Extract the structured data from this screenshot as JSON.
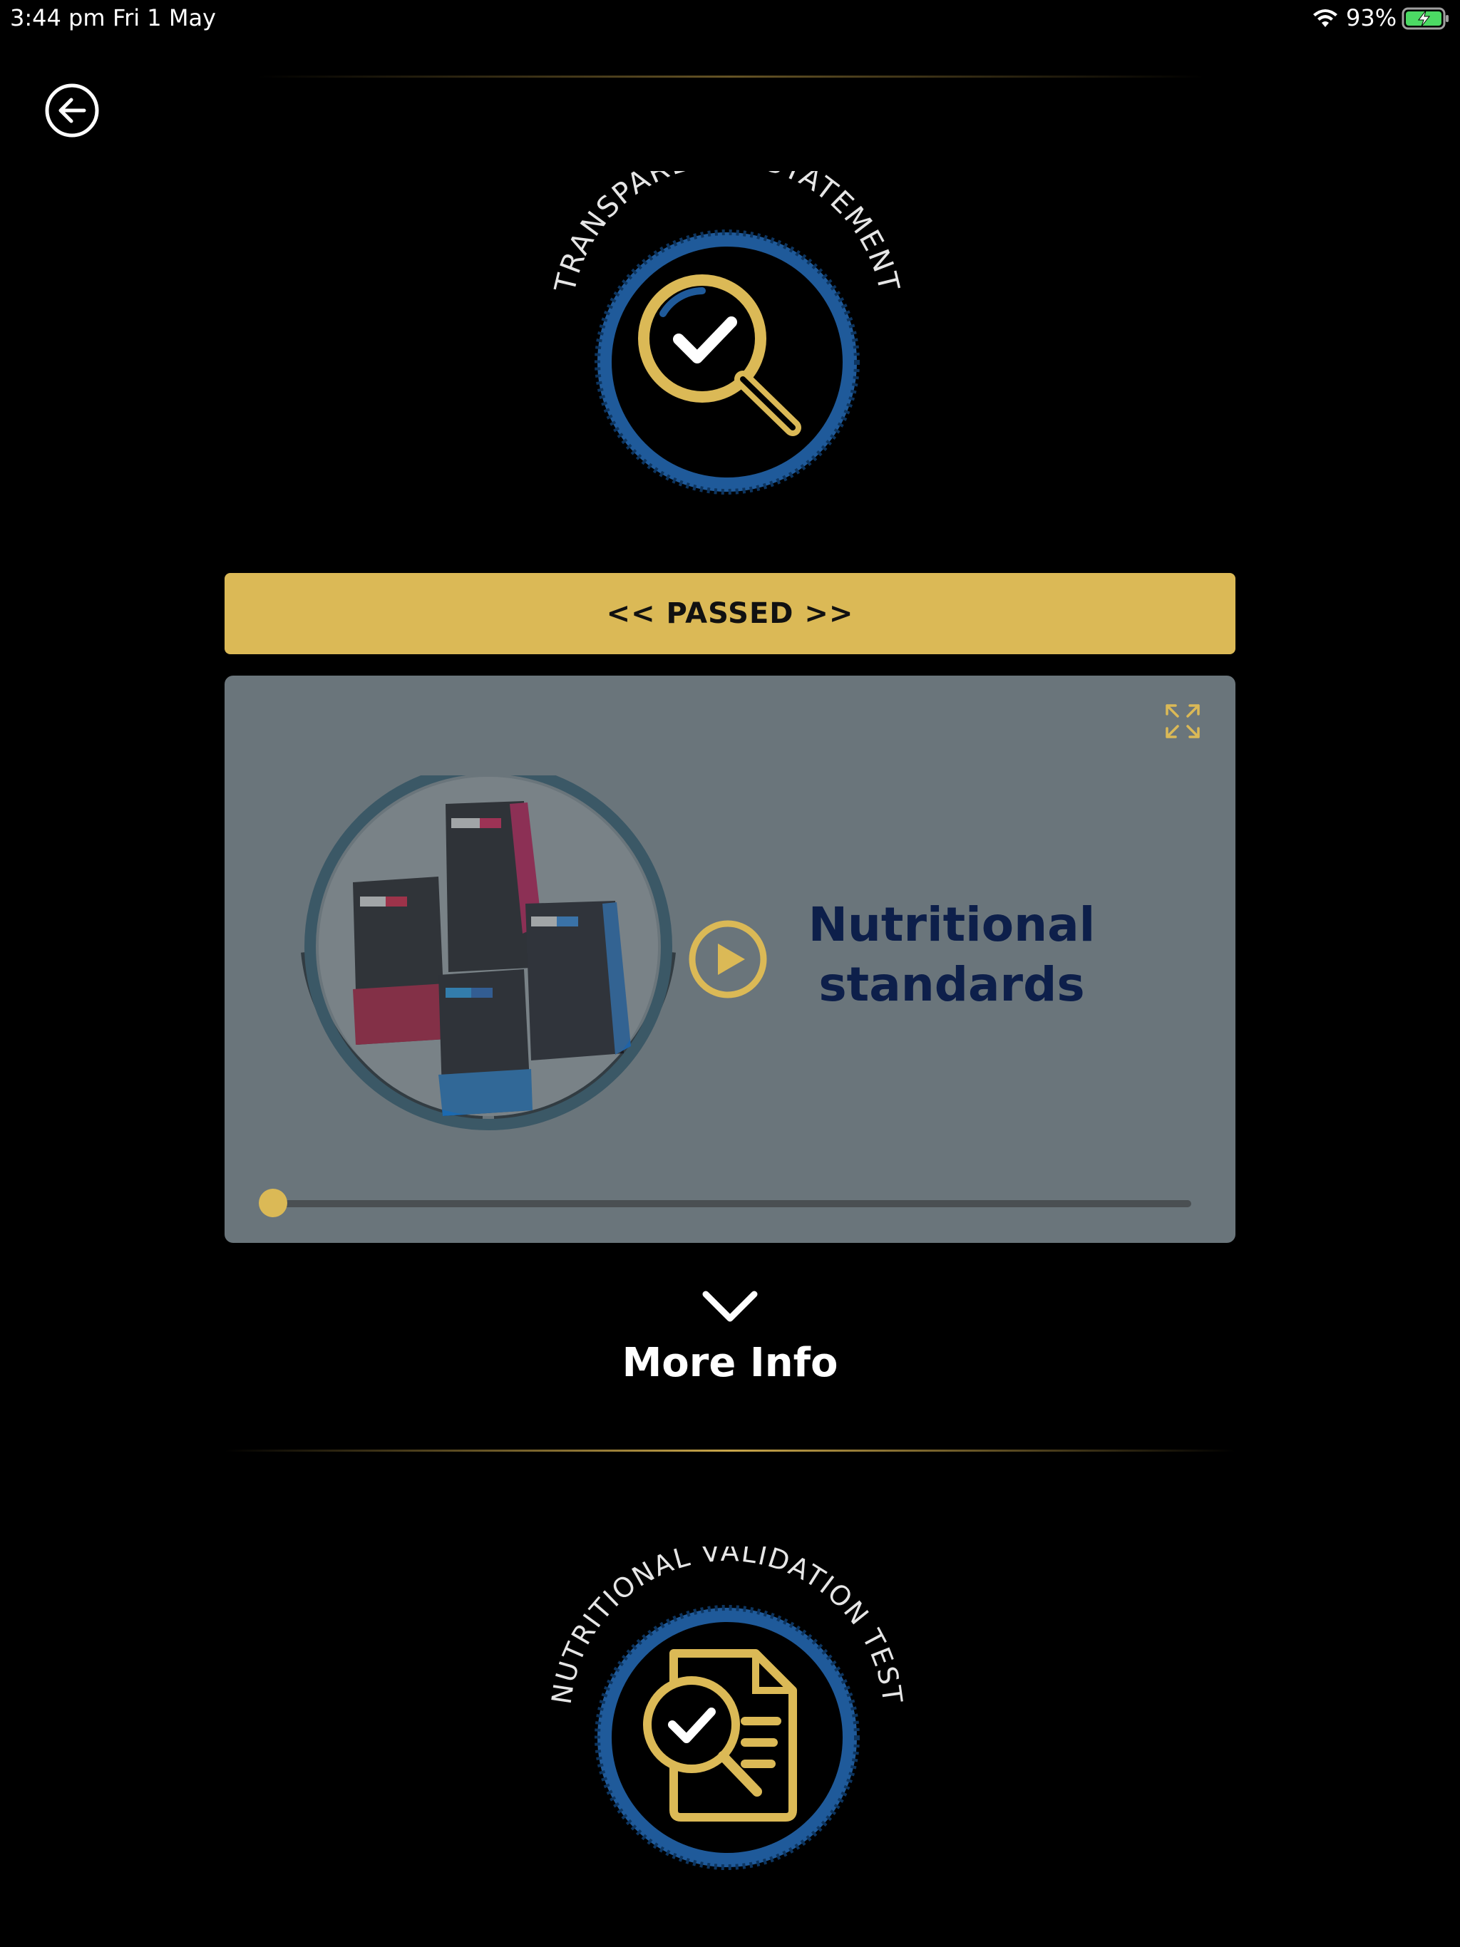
{
  "status_bar": {
    "time": "3:44 pm",
    "date": "Fri 1 May",
    "battery": "93%"
  },
  "badges": {
    "transparency": "TRANSPARENCY STATEMENT",
    "nutritional": "NUTRITIONAL VALIDATION TEST"
  },
  "result": {
    "label": "<< PASSED >>"
  },
  "video": {
    "title_line1": "Nutritional",
    "title_line2": "standards",
    "progress": 0.0
  },
  "more_info": {
    "label": "More Info"
  },
  "colors": {
    "gold": "#dbb956",
    "badge_blue": "#1f5a9a",
    "title_navy": "#0d1f4a",
    "card_bg": "#6a757b"
  }
}
